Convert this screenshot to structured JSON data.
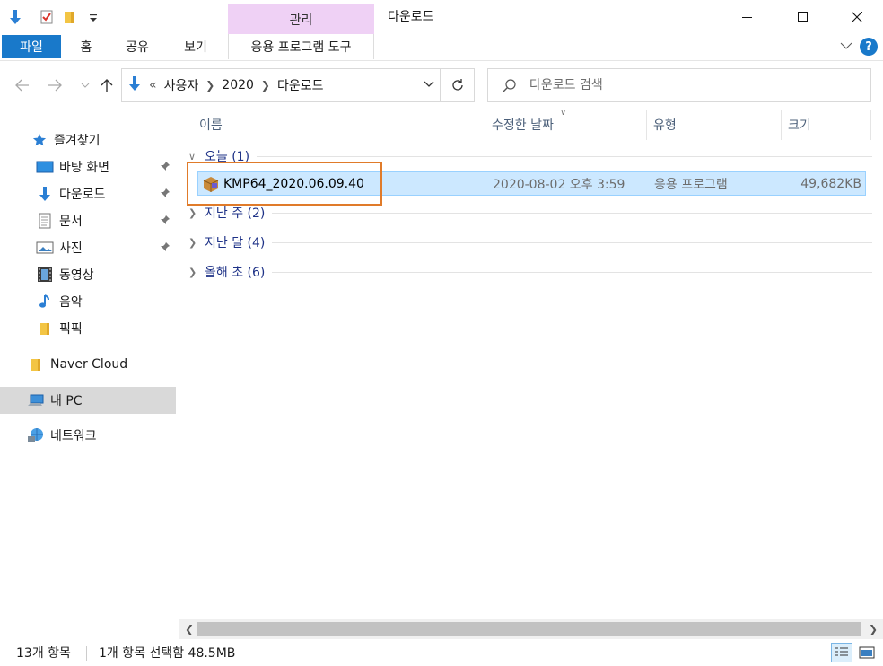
{
  "window": {
    "title": "다운로드",
    "context_tab_group": "관리"
  },
  "ribbon": {
    "tabs": {
      "file": "파일",
      "home": "홈",
      "share": "공유",
      "view": "보기",
      "app_tools": "응용 프로그램 도구"
    }
  },
  "address": {
    "overflow": "«",
    "crumbs": [
      "사용자",
      "2020",
      "다운로드"
    ]
  },
  "search": {
    "placeholder": "다운로드 검색"
  },
  "sidebar": {
    "quick_access": "즐겨찾기",
    "items": [
      {
        "label": "바탕 화면",
        "icon": "desktop-icon",
        "pinned": true
      },
      {
        "label": "다운로드",
        "icon": "download-icon",
        "pinned": true
      },
      {
        "label": "문서",
        "icon": "document-icon",
        "pinned": true
      },
      {
        "label": "사진",
        "icon": "picture-icon",
        "pinned": true
      },
      {
        "label": "동영상",
        "icon": "video-icon",
        "pinned": false
      },
      {
        "label": "음악",
        "icon": "music-icon",
        "pinned": false
      },
      {
        "label": "픽픽",
        "icon": "folder-icon",
        "pinned": false
      }
    ],
    "naver_cloud": "Naver Cloud",
    "this_pc": "내 PC",
    "network": "네트워크"
  },
  "columns": {
    "name": "이름",
    "date": "수정한 날짜",
    "type": "유형",
    "size": "크기"
  },
  "groups": {
    "today": "오늘 (1)",
    "last_week": "지난 주 (2)",
    "last_month": "지난 달 (4)",
    "earlier_this_year": "올해 초 (6)"
  },
  "files": [
    {
      "name": "KMP64_2020.06.09.40",
      "date": "2020-08-02 오후 3:59",
      "type": "응용 프로그램",
      "size": "49,682KB"
    }
  ],
  "status": {
    "item_count": "13개 항목",
    "selection": "1개 항목 선택함 48.5MB"
  },
  "colors": {
    "accent": "#1979ca",
    "context_tab": "#efd1f5",
    "selection_bg": "#cce8ff",
    "highlight_box": "#e07b2a"
  }
}
